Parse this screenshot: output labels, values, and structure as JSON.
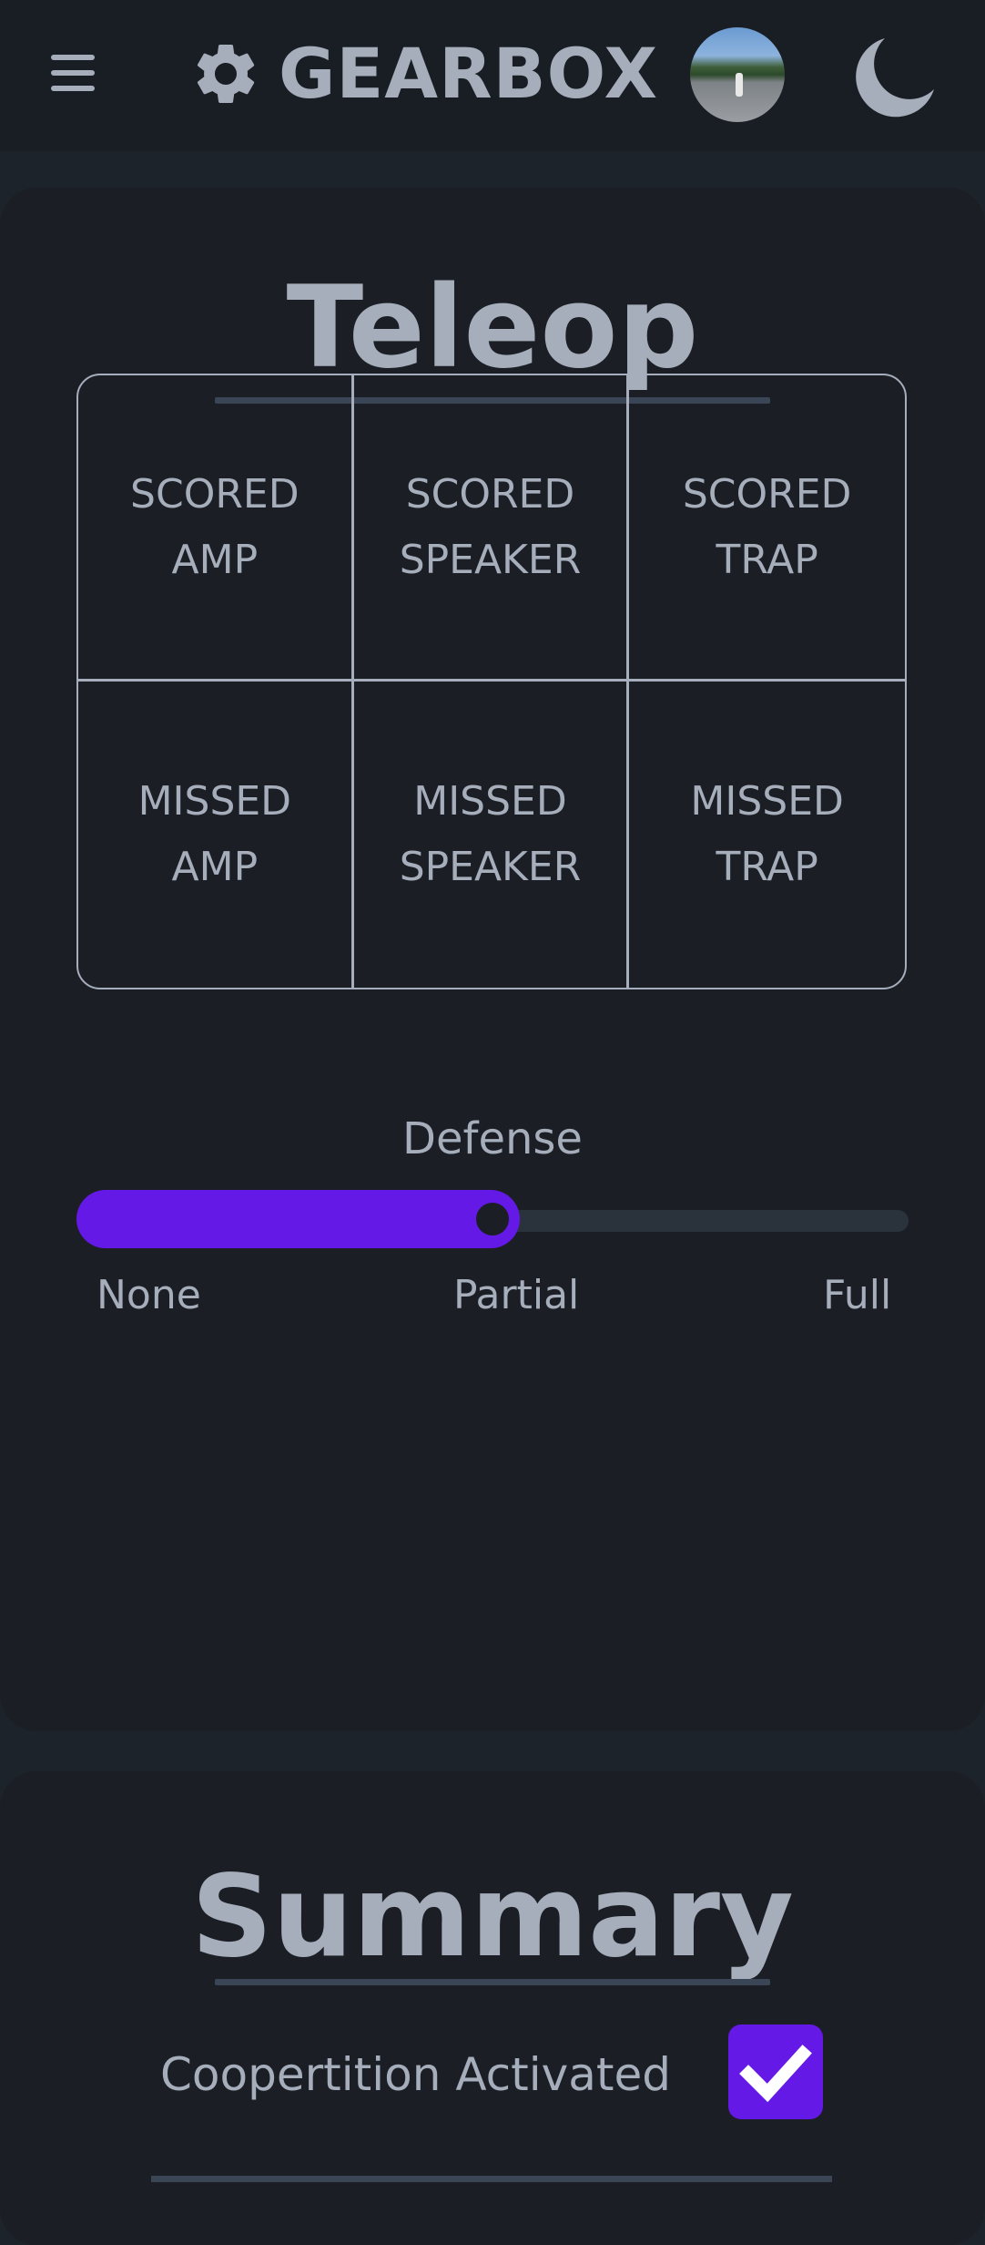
{
  "header": {
    "brand": "GEARBOX",
    "menu_icon": "hamburger-menu-icon",
    "logo_icon": "gear-icon",
    "theme_icon": "moon-icon"
  },
  "teleop": {
    "title": "Teleop",
    "grid": [
      {
        "label": "SCORED\nAMP"
      },
      {
        "label": "SCORED\nSPEAKER"
      },
      {
        "label": "SCORED\nTRAP"
      },
      {
        "label": "MISSED\nAMP"
      },
      {
        "label": "MISSED\nSPEAKER"
      },
      {
        "label": "MISSED\nTRAP"
      }
    ],
    "defense": {
      "label": "Defense",
      "options": [
        "None",
        "Partial",
        "Full"
      ],
      "selected": "Partial",
      "value_fraction": 0.5
    }
  },
  "summary": {
    "title": "Summary",
    "coopertition_label": "Coopertition Activated",
    "coopertition_checked": true
  },
  "colors": {
    "accent": "#6419e6",
    "background": "#1d232a",
    "card": "#1b1f25",
    "header": "#191e24",
    "text": "#a6adbb"
  }
}
